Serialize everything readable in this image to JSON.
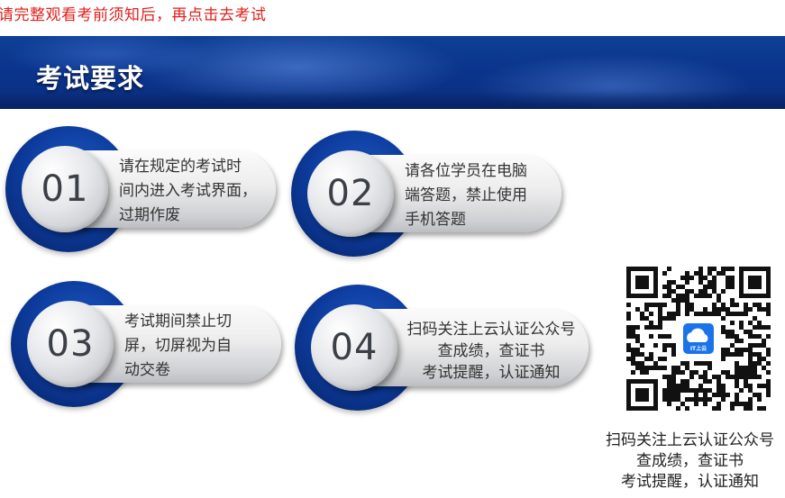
{
  "notice": "请完整观看考前须知后，再点击去考试",
  "banner": {
    "title": "考试要求"
  },
  "items": [
    {
      "number": "01",
      "lines": [
        "请在规定的考试时",
        "间内进入考试界面，",
        "过期作废"
      ]
    },
    {
      "number": "02",
      "lines": [
        "请各位学员在电脑",
        "端答题，禁止使用",
        "手机答题"
      ]
    },
    {
      "number": "03",
      "lines": [
        "考试期间禁止切",
        "屏，切屏视为自",
        "动交卷"
      ]
    },
    {
      "number": "04",
      "lines": [
        "扫码关注上云认证公众号",
        "查成绩，查证书",
        "考试提醒，认证通知"
      ]
    }
  ],
  "qr": {
    "logo_text": "IT上云",
    "caption": [
      "扫码关注上云认证公众号",
      "查成绩，查证书",
      "考试提醒，认证通知"
    ]
  },
  "colors": {
    "notice": "#e0201c",
    "banner": "#0f3f96",
    "ring": "#0d3c9e"
  }
}
